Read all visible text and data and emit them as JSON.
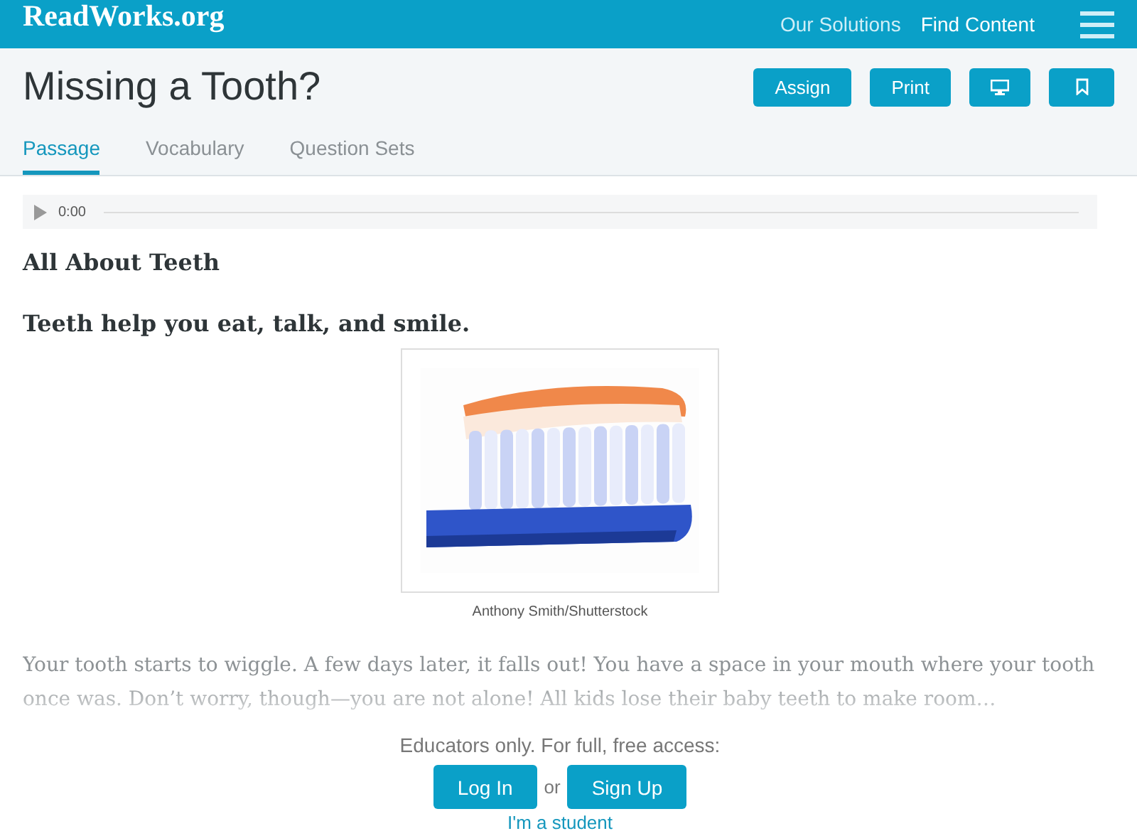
{
  "header": {
    "logo": "ReadWorks.org",
    "nav": [
      "Our Solutions",
      "Find Content"
    ]
  },
  "title": "Missing a Tooth?",
  "actions": [
    "Assign",
    "Print"
  ],
  "tabs": [
    {
      "label": "Passage",
      "selected": true
    },
    {
      "label": "Vocabulary",
      "selected": false
    },
    {
      "label": "Question Sets",
      "selected": false
    }
  ],
  "audio": {
    "time": "0:00"
  },
  "heading": "All About Teeth",
  "subheading": "Teeth help you eat, talk, and smile.",
  "image": {
    "caption": "Anthony Smith/Shutterstock"
  },
  "paragraph": "Your tooth starts to wiggle. A few days later, it falls out! You have a space in your mouth where your tooth once was. Don’t worry, though—you are not alone! All kids lose their baby teeth to make room…",
  "access": {
    "prompt": "Educators only. For full, free access:",
    "login": "Log In",
    "or": "or",
    "signup": "Sign Up",
    "student": "I'm a student"
  }
}
